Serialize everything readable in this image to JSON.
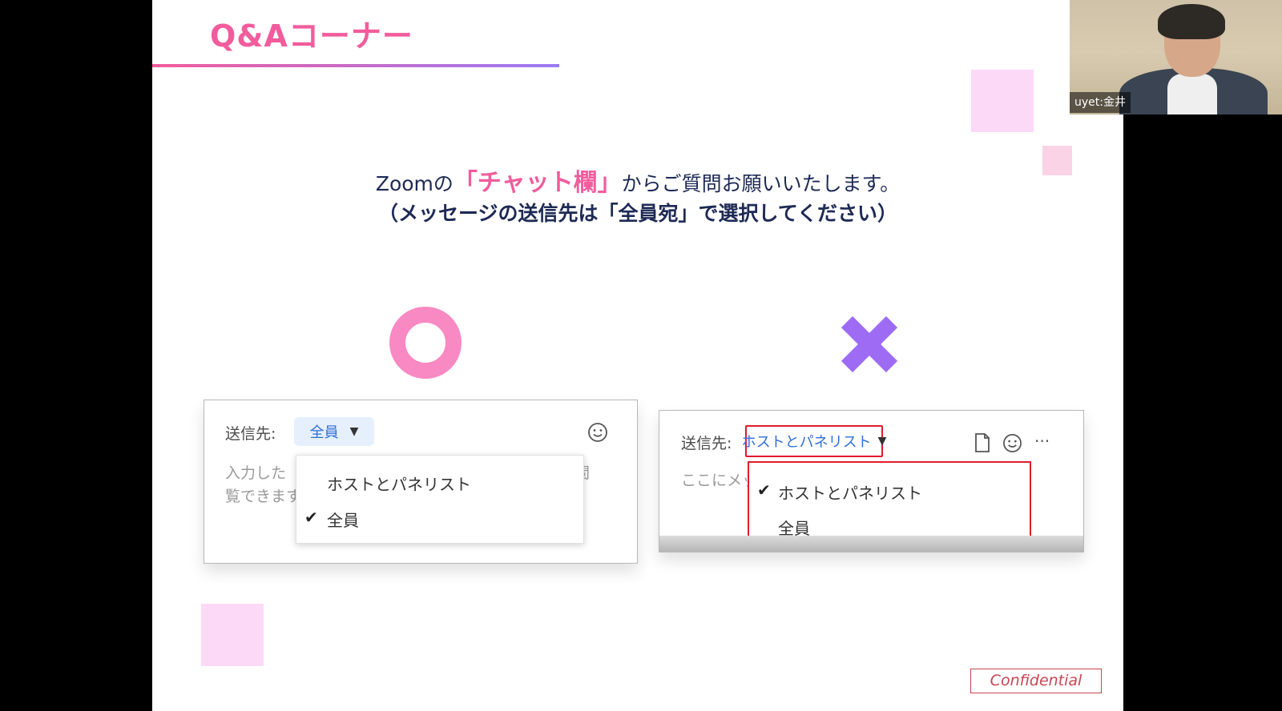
{
  "slide": {
    "title": "Q&Aコーナー",
    "instruction_prefix": "Zoomの",
    "instruction_highlight": "「チャット欄」",
    "instruction_suffix": "からご質問お願いいたします。",
    "instruction_note": "（メッセージの送信先は「全員宛」で選択してください）",
    "confidential": "Confidential",
    "colors": {
      "accent_pink": "#f25c9c",
      "accent_purple": "#9b7bf5",
      "text_navy": "#1e2a55",
      "highlight_red": "#e01c2a"
    }
  },
  "correct_example": {
    "mark": "circle-mark",
    "to_label": "送信先:",
    "selected_value": "全員",
    "placeholder_line1": "入力した",
    "placeholder_line1_end": "閲",
    "placeholder_line2": "覧できます",
    "menu_items": [
      {
        "label": "ホストとパネリスト",
        "checked": false
      },
      {
        "label": "全員",
        "checked": true
      }
    ],
    "check_glyph": "✔",
    "icons": [
      "emoji-icon"
    ]
  },
  "wrong_example": {
    "mark": "cross-mark",
    "to_label": "送信先:",
    "selected_value": "ホストとパネリスト",
    "placeholder": "ここにメッセ",
    "menu_items": [
      {
        "label": "ホストとパネリスト",
        "checked": true
      },
      {
        "label": "全員",
        "checked": false
      }
    ],
    "check_glyph": "✔",
    "icons": [
      "file-icon",
      "emoji-icon",
      "more-icon"
    ],
    "more_glyph": "···"
  },
  "video": {
    "participant_name": "uyet:金井"
  }
}
